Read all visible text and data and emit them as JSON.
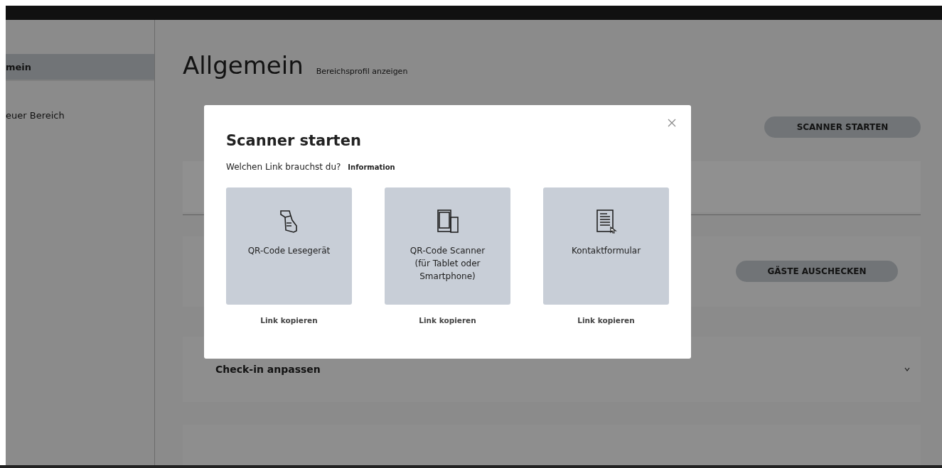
{
  "sidebar": {
    "items": [
      {
        "label": "mein",
        "selected": true
      },
      {
        "label": "euer Bereich",
        "selected": false
      }
    ]
  },
  "main": {
    "title": "Allgemein",
    "profile_link": "Bereichsprofil anzeigen",
    "scanner_button": "SCANNER STARTEN",
    "checkout_button": "GÄSTE AUSCHECKEN",
    "sections": [
      {
        "title": "Check-in anpassen",
        "expanded": false
      }
    ]
  },
  "modal": {
    "title": "Scanner starten",
    "question": "Welchen Link brauchst du?",
    "info_link": "Information",
    "options": [
      {
        "kind": "reader",
        "label": "QR-Code Lesegerät",
        "link": "Link kopieren"
      },
      {
        "kind": "devices",
        "label": "QR-Code Scanner (für Tablet oder Smartphone)",
        "link": "Link kopieren"
      },
      {
        "kind": "form",
        "label": "Kontaktformular",
        "link": "Link kopieren"
      }
    ]
  }
}
